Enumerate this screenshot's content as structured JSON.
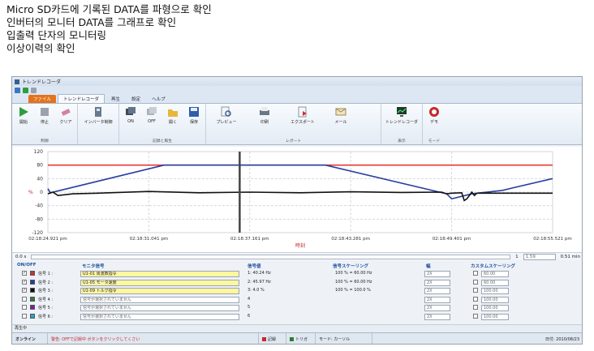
{
  "caption": {
    "lines": [
      "Micro SD카드에 기록된 DATA를 파형으로 확인",
      "인버터의 모니터 DATA를 그래프로 확인",
      "입출력 단자의 모니터링",
      "이상이력의 확인"
    ]
  },
  "window": {
    "title": "トレンドレコーダ"
  },
  "tabs": [
    "ファイル",
    "トレンドレコーダ",
    "再生",
    "設定",
    "ヘルプ"
  ],
  "ribbon": {
    "groups": [
      {
        "label": "制御",
        "buttons": [
          "開始",
          "停止",
          "クリア"
        ]
      },
      {
        "label": "",
        "buttons": [
          "インバータ制御"
        ]
      },
      {
        "label": "記録と再生",
        "buttons": [
          "ON",
          "OFF",
          "開く",
          "保存"
        ]
      },
      {
        "label": "レポート",
        "buttons": [
          "プレビュー",
          "印刷",
          "エクスポート",
          "メール"
        ]
      },
      {
        "label": "表示",
        "buttons": [
          "トレンドレコーダ"
        ]
      },
      {
        "label": "モード",
        "buttons": [
          "デモ"
        ]
      }
    ]
  },
  "chart_data": {
    "type": "line",
    "ylim": [
      -120,
      120
    ],
    "yticks": [
      120,
      80,
      40,
      0,
      -40,
      -80,
      -120
    ],
    "ylabel": "%",
    "xticks": [
      "02:18:24.921 pm",
      "02:18:31.041 pm",
      "02:18:37.161 pm",
      "02:18:43.281 pm",
      "02:18:49.401 pm",
      "02:18:55.521 pm"
    ],
    "xlabel": "時刻",
    "cursor_x": 0.38,
    "series": [
      {
        "color": "#e53935",
        "x": [
          0,
          1
        ],
        "y": [
          80,
          80
        ]
      },
      {
        "color": "#2a3f9e",
        "x": [
          0,
          0.005,
          0.23,
          0.55,
          0.79,
          0.8,
          0.84,
          0.9,
          1.0
        ],
        "y": [
          10,
          -2,
          80,
          80,
          -5,
          -20,
          -5,
          5,
          40
        ]
      },
      {
        "color": "#111111",
        "x": [
          0,
          0.01,
          0.02,
          0.05,
          0.1,
          0.2,
          0.3,
          0.4,
          0.5,
          0.6,
          0.7,
          0.78,
          0.79,
          0.8,
          0.82,
          0.825,
          0.83,
          0.84,
          0.845,
          0.85,
          0.88,
          1.0
        ],
        "y": [
          -5,
          0,
          -10,
          -5,
          -3,
          2,
          -2,
          0,
          -2,
          1,
          -1,
          0,
          -5,
          -3,
          -2,
          -25,
          -20,
          0,
          -10,
          -3,
          -3,
          -3
        ]
      }
    ]
  },
  "timebar": {
    "left_value": "0.0 s",
    "mid_value": "1",
    "right_value": "1.59",
    "rate_value": "0.51 min"
  },
  "panel": {
    "headers": {
      "onoff": "ON/OFF",
      "monitor": "モニタ信号",
      "value": "信号値",
      "scaling": "信号スケーリング",
      "width": "幅",
      "custom": "カスタムスケーリング"
    },
    "rows": [
      {
        "checked": true,
        "color": "#d32f2f",
        "name": "信号 1 :",
        "signal": "U1-01 周波数指令",
        "value": "1: 40.24 Hz",
        "scaling": "100 % = 60.00 Hz",
        "width": "2X",
        "custom": "60.00",
        "active": true
      },
      {
        "checked": true,
        "color": "#1e3fa8",
        "name": "信号 2 :",
        "signal": "U1-05 モータ速度",
        "value": "2: 45.97 Hz",
        "scaling": "100 % = 60.00 Hz",
        "width": "2X",
        "custom": "60.00",
        "active": true
      },
      {
        "checked": true,
        "color": "#111111",
        "name": "信号 3 :",
        "signal": "U1-09 トルク指令",
        "value": "3: 4.0 %",
        "scaling": "100 % = 100.0 %",
        "width": "2X",
        "custom": "100.00",
        "active": true
      },
      {
        "checked": false,
        "color": "#2e7d32",
        "name": "信号 4 :",
        "signal": "信号が選択されていません",
        "value": "4",
        "scaling": "",
        "width": "2X",
        "custom": "100.00",
        "active": false
      },
      {
        "checked": false,
        "color": "#7b1fa2",
        "name": "信号 5 :",
        "signal": "信号が選択されていません",
        "value": "5",
        "scaling": "",
        "width": "2X",
        "custom": "100.00",
        "active": false
      },
      {
        "checked": false,
        "color": "#26a3c8",
        "name": "信号 6 :",
        "signal": "信号が選択されていません",
        "value": "6",
        "scaling": "",
        "width": "2X",
        "custom": "100.00",
        "active": false
      }
    ]
  },
  "drawer_label": "再生中",
  "statusbar": {
    "online": "オンライン",
    "message": "警告: OFFで記録中 ボタンをクリックしてくさい",
    "rec": "記録",
    "trip": "トリガ",
    "mode": "モード: カーソル",
    "date": "日付: 2010/08/23"
  },
  "colors": {
    "accent": "#e3731c",
    "ribbon": "#e3ebf5",
    "signal_red": "#e53935",
    "signal_blue": "#2a3f9e"
  }
}
